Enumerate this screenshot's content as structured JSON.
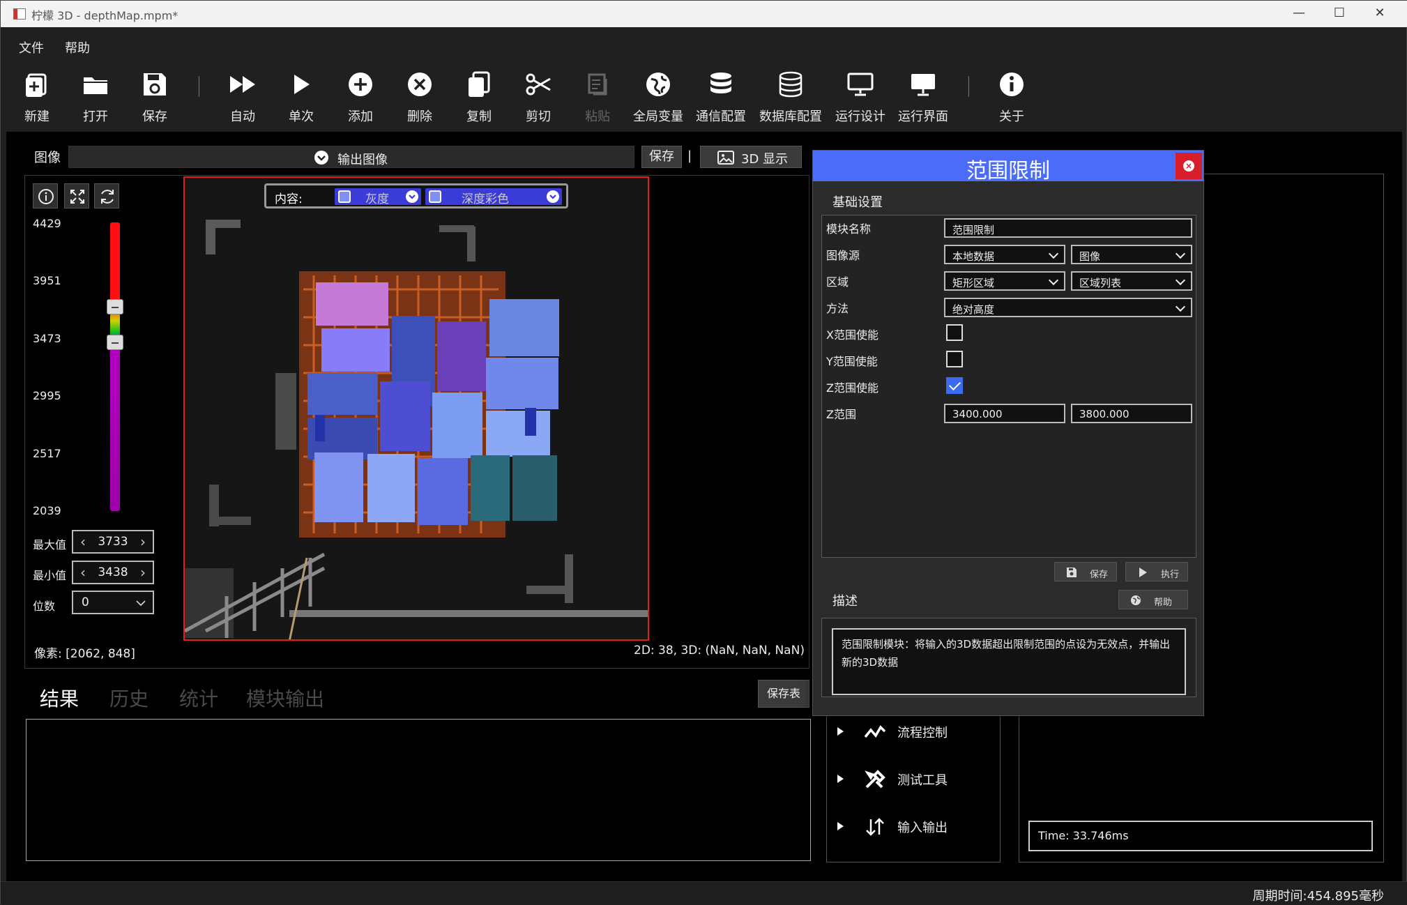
{
  "window": {
    "title": "柠檬 3D  - depthMap.mpm*",
    "controls": {
      "minimize": "—",
      "maximize": "☐",
      "close": "✕"
    }
  },
  "menu": [
    "文件",
    "帮助"
  ],
  "toolbar": [
    {
      "label": "新建",
      "icon": "new-file-icon"
    },
    {
      "label": "打开",
      "icon": "folder-icon"
    },
    {
      "label": "保存",
      "icon": "save-icon"
    },
    {
      "label": "自动",
      "icon": "fast-forward-icon"
    },
    {
      "label": "单次",
      "icon": "play-icon"
    },
    {
      "label": "添加",
      "icon": "plus-circle-icon"
    },
    {
      "label": "删除",
      "icon": "x-circle-icon"
    },
    {
      "label": "复制",
      "icon": "copy-icon"
    },
    {
      "label": "剪切",
      "icon": "scissors-icon"
    },
    {
      "label": "粘贴",
      "icon": "paste-icon",
      "disabled": true
    },
    {
      "label": "全局变量",
      "icon": "globe-icon"
    },
    {
      "label": "通信配置",
      "icon": "database-icon"
    },
    {
      "label": "数据库配置",
      "icon": "database-icon"
    },
    {
      "label": "运行设计",
      "icon": "monitor-icon"
    },
    {
      "label": "运行界面",
      "icon": "monitor-icon"
    },
    {
      "label": "关于",
      "icon": "info-icon"
    }
  ],
  "image_panel": {
    "label": "图像",
    "selector": "输出图像",
    "save_button": "保存",
    "separator": "|",
    "display_3d": "3D 显示",
    "content_label": "内容:",
    "content_options": [
      {
        "label": "灰度",
        "checked": true
      },
      {
        "label": "深度彩色",
        "checked": true
      }
    ],
    "ticks": [
      "4429",
      "3951",
      "3473",
      "2995",
      "2517",
      "2039"
    ],
    "max_label": "最大值",
    "max_value": "3733",
    "min_label": "最小值",
    "min_value": "3438",
    "digits_label": "位数",
    "digits_value": "0",
    "pixel_readout": "像素: [2062, 848]",
    "value_readout": "2D: 38, 3D: (NaN, NaN, NaN)"
  },
  "results": {
    "tabs": [
      "结果",
      "历史",
      "统计",
      "模块输出"
    ],
    "active_tab": 0,
    "save_table": "保存表"
  },
  "tree": [
    {
      "label": "流程控制",
      "icon": "flow-control-icon"
    },
    {
      "label": "测试工具",
      "icon": "tools-icon"
    },
    {
      "label": "输入输出",
      "icon": "input-output-icon"
    }
  ],
  "time_readout": "Time: 33.746ms",
  "status": "周期时间:454.895毫秒",
  "dialog": {
    "title": "范围限制",
    "section_basic": "基础设置",
    "fields": {
      "module_name_label": "模块名称",
      "module_name_value": "范围限制",
      "image_source_label": "图像源",
      "image_source_value1": "本地数据",
      "image_source_value2": "图像",
      "region_label": "区域",
      "region_value1": "矩形区域",
      "region_value2": "区域列表",
      "method_label": "方法",
      "method_value": "绝对高度",
      "x_enable_label": "X范围使能",
      "y_enable_label": "Y范围使能",
      "z_enable_label": "Z范围使能",
      "x_enable": false,
      "y_enable": false,
      "z_enable": true,
      "z_range_label": "Z范围",
      "z_min": "3400.000",
      "z_max": "3800.000"
    },
    "save_button": "保存",
    "run_button": "执行",
    "section_desc": "描述",
    "help_button": "帮助",
    "description": "范围限制模块：将输入的3D数据超出限制范围的点设为无效点，并输出新的3D数据"
  },
  "colors": {
    "accent": "#4a6cf7",
    "close_red": "#d81e2a",
    "roi_red": "#e51c1c",
    "content_blue": "#3b3bd8"
  }
}
